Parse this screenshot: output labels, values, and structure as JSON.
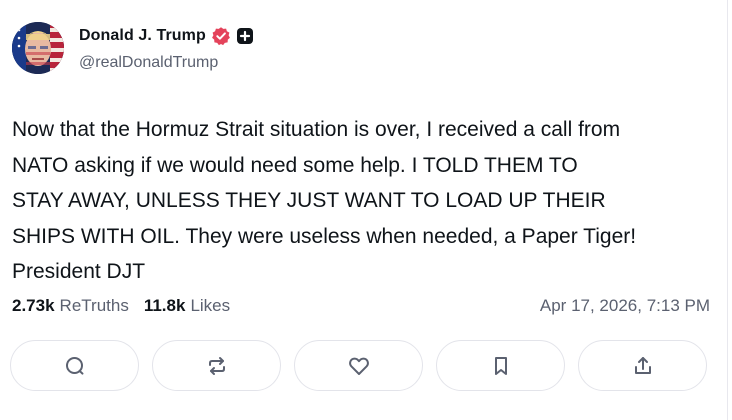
{
  "author": {
    "display_name": "Donald J. Trump",
    "handle": "@realDonaldTrump",
    "verified_icon": "verified-badge-icon",
    "badge_icon": "plus-badge-icon",
    "verified_color": "#e4435b"
  },
  "post": {
    "text": "Now that the Hormuz Strait situation is over, I received a call from\nNATO asking if we would need some help. I  TOLD THEM TO\nSTAY AWAY, UNLESS THEY JUST WANT TO LOAD UP THEIR\nSHIPS WITH OIL. They were useless when needed, a Paper Tiger!\nPresident DJT",
    "retruths_count": "2.73k",
    "retruths_label": "ReTruths",
    "likes_count": "11.8k",
    "likes_label": "Likes",
    "timestamp": "Apr 17, 2026, 7:13 PM"
  },
  "actions": [
    {
      "name": "reply",
      "icon": "comment-icon"
    },
    {
      "name": "retruth",
      "icon": "repost-icon"
    },
    {
      "name": "like",
      "icon": "heart-icon"
    },
    {
      "name": "bookmark",
      "icon": "bookmark-icon"
    },
    {
      "name": "share",
      "icon": "share-icon"
    }
  ],
  "colors": {
    "text_primary": "#0f1419",
    "text_secondary": "#5b6170",
    "icon_color": "#5b6170",
    "button_border": "#e3e4ea"
  }
}
